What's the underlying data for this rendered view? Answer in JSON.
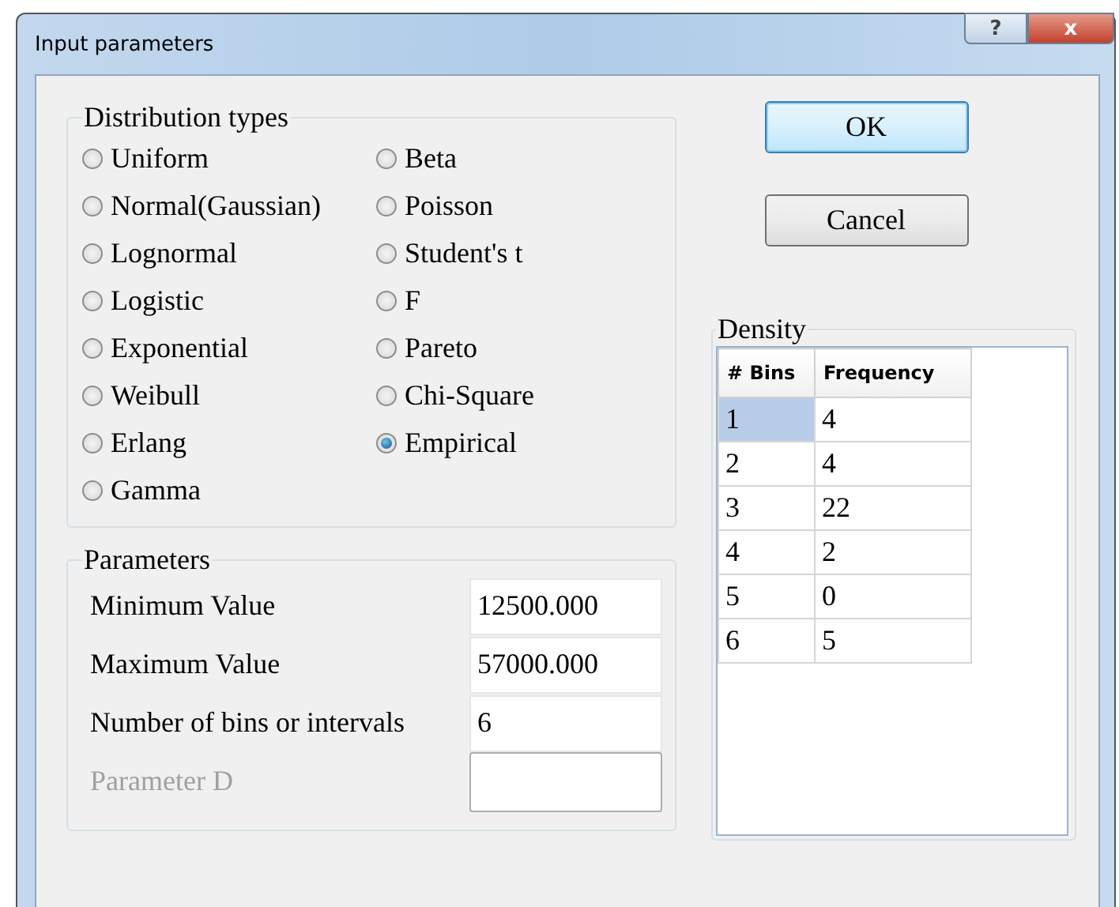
{
  "window": {
    "title": "Input parameters",
    "help_button": "?",
    "close_button": "x"
  },
  "distribution_types": {
    "title": "Distribution types",
    "options": [
      {
        "label": "Uniform",
        "selected": false
      },
      {
        "label": "Normal(Gaussian)",
        "selected": false
      },
      {
        "label": "Lognormal",
        "selected": false
      },
      {
        "label": "Logistic",
        "selected": false
      },
      {
        "label": "Exponential",
        "selected": false
      },
      {
        "label": "Weibull",
        "selected": false
      },
      {
        "label": "Erlang",
        "selected": false
      },
      {
        "label": "Gamma",
        "selected": false
      },
      {
        "label": "Beta",
        "selected": false
      },
      {
        "label": "Poisson",
        "selected": false
      },
      {
        "label": "Student's t",
        "selected": false
      },
      {
        "label": "F",
        "selected": false
      },
      {
        "label": "Pareto",
        "selected": false
      },
      {
        "label": "Chi-Square",
        "selected": false
      },
      {
        "label": "Empirical",
        "selected": true
      }
    ]
  },
  "parameters": {
    "title": "Parameters",
    "fields": [
      {
        "label": "Minimum Value",
        "value": "12500.000",
        "disabled": false
      },
      {
        "label": "Maximum Value",
        "value": "57000.000",
        "disabled": false
      },
      {
        "label": "Number of bins or intervals",
        "value": "6",
        "disabled": false
      },
      {
        "label": "Parameter D",
        "disabled": true
      }
    ]
  },
  "buttons": [
    {
      "label": "OK",
      "default": true
    },
    {
      "label": "Cancel",
      "default": false
    }
  ],
  "density": {
    "title": "Density",
    "columns": [
      "# Bins",
      "Frequency"
    ],
    "rows": [
      {
        "cells": [
          "1",
          "4"
        ],
        "selected": true
      },
      {
        "cells": [
          "2",
          "4"
        ],
        "selected": false
      },
      {
        "cells": [
          "3",
          "22"
        ],
        "selected": false
      },
      {
        "cells": [
          "4",
          "2"
        ],
        "selected": false
      },
      {
        "cells": [
          "5",
          "0"
        ],
        "selected": false
      },
      {
        "cells": [
          "6",
          "5"
        ],
        "selected": false
      }
    ]
  }
}
